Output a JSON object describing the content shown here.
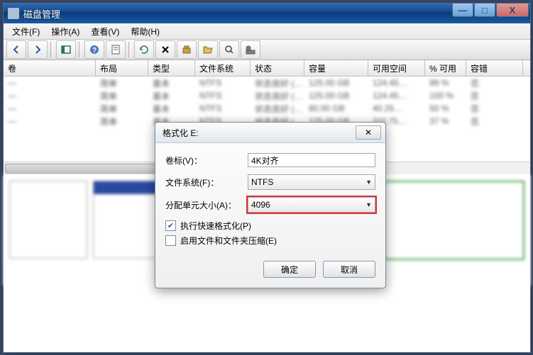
{
  "window": {
    "title": "磁盘管理",
    "buttons": {
      "min": "—",
      "max": "□",
      "close": "X"
    }
  },
  "menu": {
    "file": "文件(F)",
    "action": "操作(A)",
    "view": "查看(V)",
    "help": "帮助(H)"
  },
  "columns": {
    "vol": "卷",
    "layout": "布局",
    "type": "类型",
    "fs": "文件系统",
    "status": "状态",
    "capacity": "容量",
    "free": "可用空间",
    "pct": "% 可用",
    "tol": "容错"
  },
  "rows": [
    {
      "vol": "—",
      "layout": "简单",
      "type": "基本",
      "fs": "NTFS",
      "status": "状态良好 (…",
      "cap": "125.00 GB",
      "free": "124.45…",
      "pct": "99 %",
      "tol": "否"
    },
    {
      "vol": "—",
      "layout": "简单",
      "type": "基本",
      "fs": "NTFS",
      "status": "状态良好 (…",
      "cap": "125.00 GB",
      "free": "124.45…",
      "pct": "100 %",
      "tol": "否"
    },
    {
      "vol": "—",
      "layout": "简单",
      "type": "基本",
      "fs": "NTFS",
      "status": "状态良好 (…",
      "cap": "80.00 GB",
      "free": "40.25…",
      "pct": "50 %",
      "tol": "否"
    },
    {
      "vol": "—",
      "layout": "简单",
      "type": "基本",
      "fs": "NTFS",
      "status": "状态良好 (…",
      "cap": "125.00 GB",
      "free": "110.75…",
      "pct": "37 %",
      "tol": "否"
    }
  ],
  "dialog": {
    "title": "格式化 E:",
    "close": "✕",
    "label_vol": "卷标(V)：",
    "label_fs": "文件系统(F)：",
    "label_au": "分配单元大小(A)：",
    "value_vol": "4K对齐",
    "value_fs": "NTFS",
    "value_au": "4096",
    "chk_quick": "执行快速格式化(P)",
    "chk_compress": "启用文件和文件夹压缩(E)",
    "btn_ok": "确定",
    "btn_cancel": "取消"
  }
}
